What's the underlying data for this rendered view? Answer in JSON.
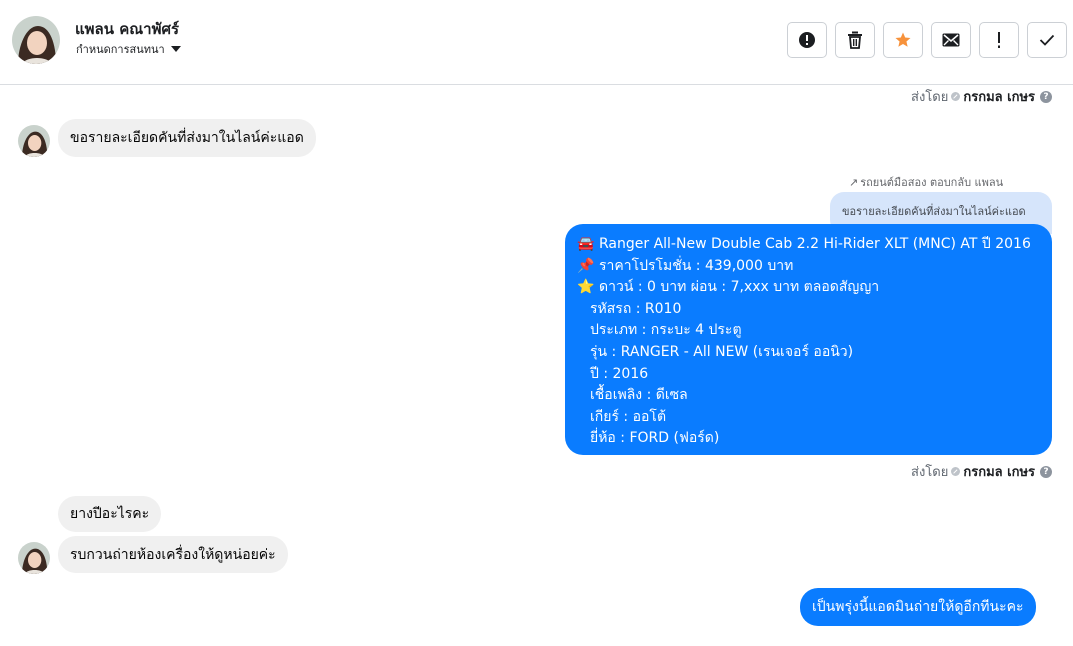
{
  "header": {
    "contact_name": "แพลน คณาพัศร์",
    "assign_label": "กำหนดการสนทนา",
    "actions": [
      {
        "name": "spam-button",
        "icon": "alert-circle-icon"
      },
      {
        "name": "delete-button",
        "icon": "trash-icon"
      },
      {
        "name": "star-button",
        "icon": "star-icon"
      },
      {
        "name": "mark-unread-button",
        "icon": "envelope-icon"
      },
      {
        "name": "important-button",
        "icon": "exclamation-icon"
      },
      {
        "name": "done-button",
        "icon": "check-icon"
      }
    ]
  },
  "colors": {
    "outgoing_bubble": "#0a7cff",
    "incoming_bubble": "#f0f0f0",
    "reply_quote": "#d6e5fb",
    "star": "#f7923b"
  },
  "conversation": {
    "sent_by_prefix": "ส่งโดย",
    "sent_by_name": "กรกมล เกษร",
    "messages": {
      "in_1": "ขอรายละเอียดคันที่ส่งมาในไลน์ค่ะแอด",
      "reply_label": "รถยนต์มือสอง ตอบกลับ แพลน",
      "reply_quote": "ขอรายละเอียดคันที่ส่งมาในไลน์ค่ะแอด",
      "car_lines": [
        {
          "emoji": "🚘",
          "text": "Ranger All-New Double Cab 2.2 Hi-Rider XLT (MNC) AT ปี 2016"
        },
        {
          "emoji": "📌",
          "text": "ราคาโปรโมชั่น  : 439,000 บาท"
        },
        {
          "emoji": "⭐",
          "text": "ดาวน์ : 0 บาท ผ่อน : 7,xxx  บาท ตลอดสัญญา"
        },
        {
          "emoji": "",
          "text": "รหัสรถ : R010"
        },
        {
          "emoji": "",
          "text": "ประเภท : กระบะ 4 ประตู"
        },
        {
          "emoji": "",
          "text": "รุ่น : RANGER - All NEW (เรนเจอร์ ออนิว)"
        },
        {
          "emoji": "",
          "text": "ปี : 2016"
        },
        {
          "emoji": "",
          "text": "เชื้อเพลิง : ดีเซล"
        },
        {
          "emoji": "",
          "text": "เกียร์ : ออโต้"
        },
        {
          "emoji": "",
          "text": "ยี่ห้อ : FORD (ฟอร์ด)"
        }
      ],
      "in_2": "ยางปีอะไรคะ",
      "in_3": "รบกวนถ่ายห้องเครื่องให้ดูหน่อยค่ะ",
      "out_2": "เป็นพรุ่งนี้แอดมินถ่ายให้ดูอีกทีนะคะ"
    }
  }
}
